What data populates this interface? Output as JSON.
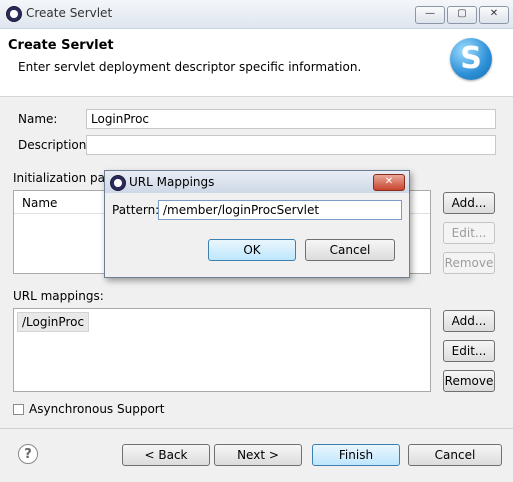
{
  "window": {
    "title": "Create Servlet",
    "minimize_glyph": "—",
    "maximize_glyph": "▢",
    "close_glyph": "✕"
  },
  "header": {
    "title": "Create Servlet",
    "description": "Enter servlet deployment descriptor specific information.",
    "logo_letter": "S"
  },
  "form": {
    "name_label": "Name:",
    "name_value": "LoginProc",
    "description_label": "Description:",
    "description_value": "",
    "init_params_label": "Initialization parameters:",
    "init_params_column": "Name",
    "init_params_buttons": {
      "add": "Add...",
      "edit": "Edit...",
      "remove": "Remove"
    },
    "url_mappings_label": "URL mappings:",
    "url_mappings": [
      "/LoginProc"
    ],
    "url_buttons": {
      "add": "Add...",
      "edit": "Edit...",
      "remove": "Remove"
    },
    "async_label": "Asynchronous Support",
    "async_checked": false
  },
  "footer": {
    "help_glyph": "?",
    "back": "< Back",
    "next": "Next >",
    "finish": "Finish",
    "cancel": "Cancel"
  },
  "dialog": {
    "title": "URL Mappings",
    "pattern_label": "Pattern:",
    "pattern_value": "/member/loginProcServlet",
    "ok": "OK",
    "cancel": "Cancel",
    "close_glyph": "✕"
  }
}
